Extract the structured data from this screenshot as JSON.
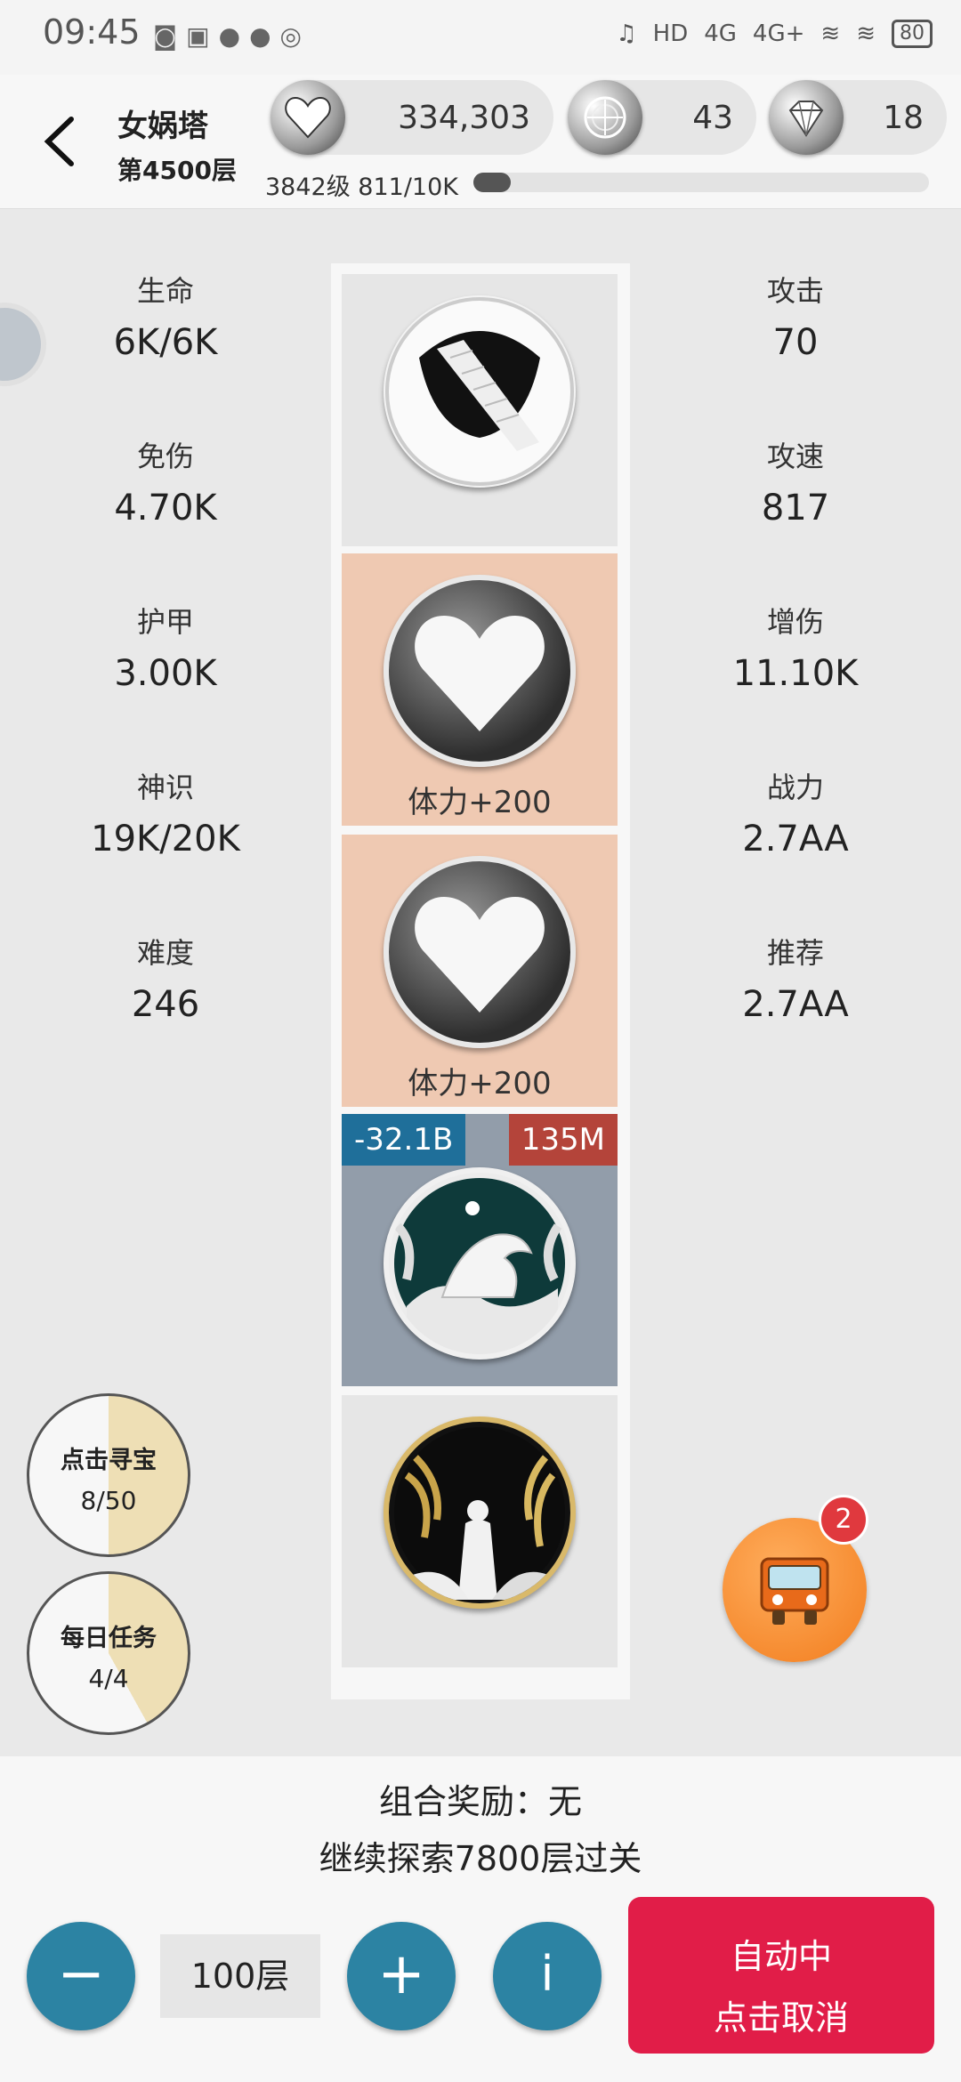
{
  "status_bar": {
    "time": "09:45",
    "network_hd": "HD",
    "net_a": "4G",
    "net_b": "4G+",
    "battery": "80"
  },
  "header": {
    "tower_name": "女娲塔",
    "floor_label": "第4500层",
    "resources": [
      {
        "icon": "heart-icon",
        "value": "334,303"
      },
      {
        "icon": "compass-icon",
        "value": "43"
      },
      {
        "icon": "diamond-icon",
        "value": "18"
      }
    ],
    "level_text": "3842级 811/10K",
    "xp_progress": 0.0811
  },
  "stats_left": [
    {
      "label": "生命",
      "value": "6K/6K"
    },
    {
      "label": "免伤",
      "value": "4.70K"
    },
    {
      "label": "护甲",
      "value": "3.00K"
    },
    {
      "label": "神识",
      "value": "19K/20K"
    },
    {
      "label": "难度",
      "value": "246"
    }
  ],
  "stats_right": [
    {
      "label": "攻击",
      "value": "70"
    },
    {
      "label": "攻速",
      "value": "817"
    },
    {
      "label": "增伤",
      "value": "11.10K"
    },
    {
      "label": "战力",
      "value": "2.7AA"
    },
    {
      "label": "推荐",
      "value": "2.7AA"
    }
  ],
  "tower_tiles": [
    {
      "kind": "stairs",
      "caption": ""
    },
    {
      "kind": "heart",
      "caption": "体力+200"
    },
    {
      "kind": "heart",
      "caption": "体力+200"
    },
    {
      "kind": "dragon",
      "tag_left": "-32.1B",
      "tag_right": "135M"
    },
    {
      "kind": "nuwa",
      "caption": ""
    }
  ],
  "side": {
    "treasure": {
      "title": "点击寻宝",
      "count": "8/50",
      "progress": 0.5
    },
    "daily": {
      "title": "每日任务",
      "count": "4/4",
      "progress": 0.42
    },
    "truck_badge": "2"
  },
  "bottom": {
    "combo_reward": "组合奖励：无",
    "explore_text": "继续探索7800层过关",
    "floor_value": "100层",
    "minus_symbol": "−",
    "plus_symbol": "+",
    "info_symbol": "i",
    "auto_line1": "自动中",
    "auto_line2": "点击取消"
  },
  "colors": {
    "accent_blue": "#2c83a3",
    "auto_red": "#e11d48",
    "peach_tile": "#efc9b2",
    "tag_blue": "#1f6f9a",
    "tag_red": "#b4443a"
  }
}
